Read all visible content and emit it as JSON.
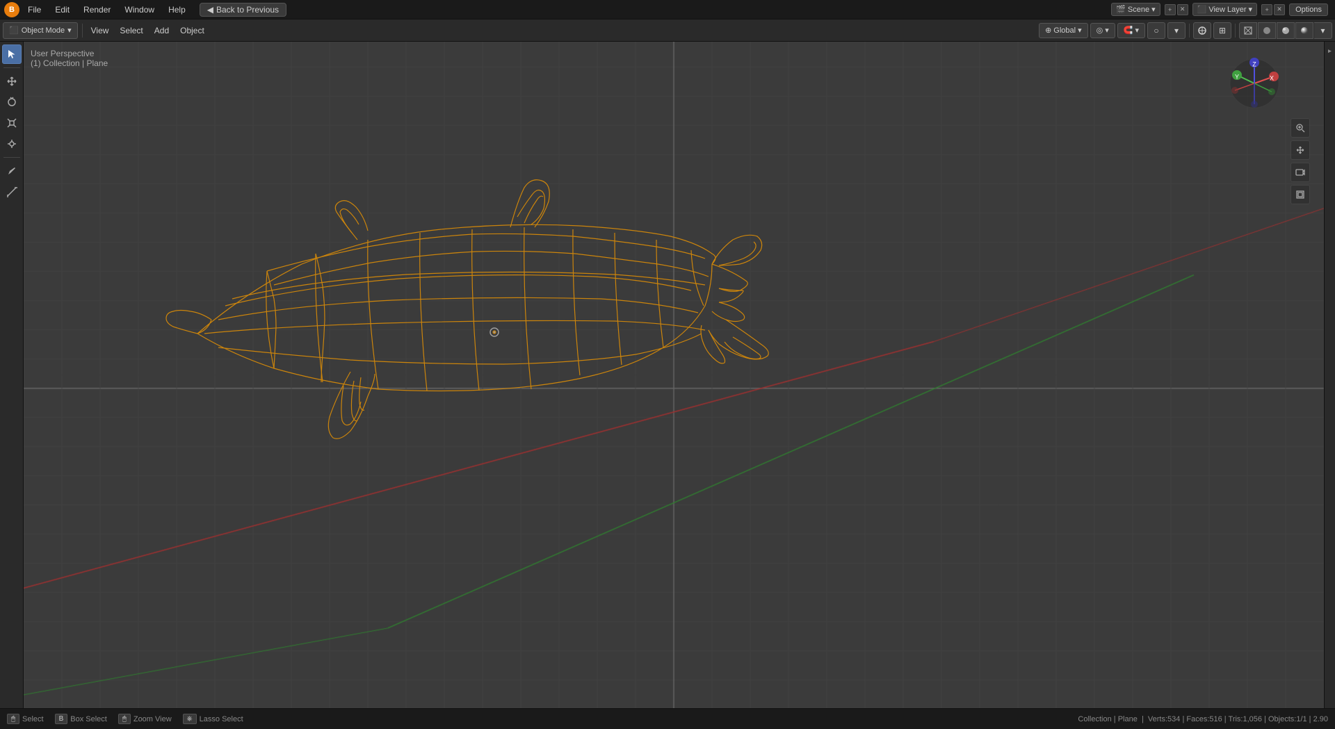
{
  "topbar": {
    "blender_icon": "B",
    "menus": [
      "File",
      "Edit",
      "Render",
      "Window",
      "Help"
    ],
    "back_to_previous": "Back to Previous",
    "scene_name": "Scene",
    "view_layer_name": "View Layer",
    "options_label": "Options"
  },
  "header": {
    "mode_label": "Object Mode",
    "view_label": "View",
    "select_label": "Select",
    "add_label": "Add",
    "object_label": "Object",
    "transform_global": "Global",
    "viewport_info_line1": "User Perspective",
    "viewport_info_line2": "(1) Collection | Plane"
  },
  "toolbar": {
    "tools": [
      "cursor",
      "move",
      "rotate",
      "scale",
      "transform",
      "annotate",
      "measure"
    ],
    "active_tool": "cursor"
  },
  "gizmo": {
    "x_label": "X",
    "y_label": "Y",
    "z_label": "Z"
  },
  "status": {
    "select_key": "Select",
    "box_select_key": "Box Select",
    "zoom_view_key": "Zoom View",
    "lasso_select_key": "Lasso Select",
    "collection_label": "Collection | Plane",
    "stats": "Verts:534 | Faces:516 | Tris:1,056 | Objects:1/1 | 2.90"
  }
}
